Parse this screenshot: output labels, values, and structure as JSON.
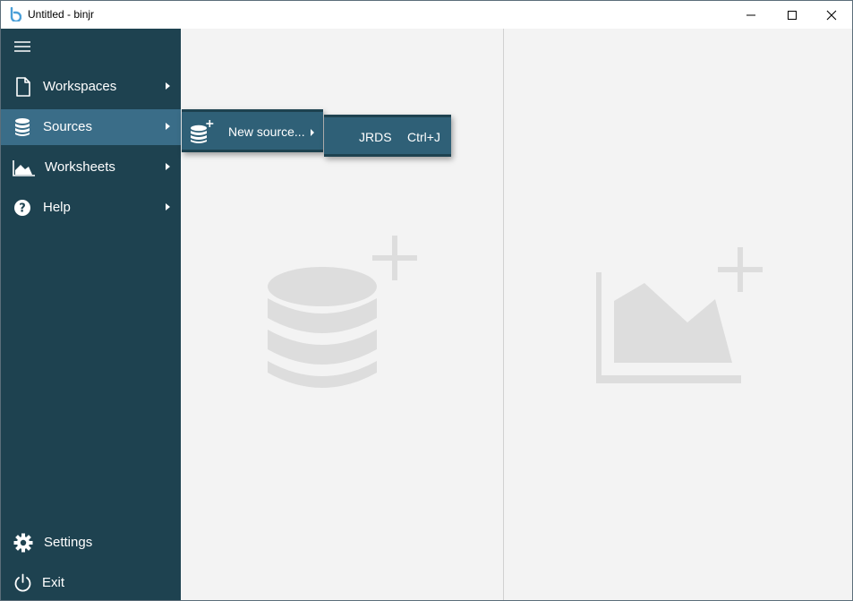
{
  "window": {
    "title": "Untitled - binjr",
    "icons": {
      "logo": "binjr-logo-icon",
      "minimize": "minimize-icon",
      "maximize": "maximize-icon",
      "close": "close-icon"
    }
  },
  "sidebar": {
    "menu_icon": "hamburger-icon",
    "items": [
      {
        "label": "Workspaces",
        "icon": "document-icon",
        "has_submenu": true
      },
      {
        "label": "Sources",
        "icon": "database-icon",
        "has_submenu": true,
        "active": true
      },
      {
        "label": "Worksheets",
        "icon": "area-chart-icon",
        "has_submenu": true
      },
      {
        "label": "Help",
        "icon": "help-icon",
        "has_submenu": true
      }
    ],
    "bottom_items": [
      {
        "label": "Settings",
        "icon": "gear-icon"
      },
      {
        "label": "Exit",
        "icon": "power-icon"
      }
    ]
  },
  "sources_menu": {
    "items": [
      {
        "label": "New source...",
        "icon": "database-add-icon",
        "has_submenu": true
      }
    ]
  },
  "new_source_menu": {
    "items": [
      {
        "label": "JRDS",
        "shortcut": "Ctrl+J"
      }
    ]
  },
  "panes": {
    "left_placeholder_icon": "add-source-icon",
    "right_placeholder_icon": "add-worksheet-icon"
  },
  "colors": {
    "sidebar_bg": "#1e4250",
    "active_item_bg": "#3a6d88",
    "menu_bg": "#2f6077",
    "content_bg": "#f3f3f3",
    "placeholder_icon": "#dddddd"
  }
}
